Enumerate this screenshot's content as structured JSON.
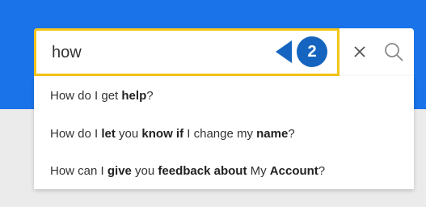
{
  "search": {
    "value": "how",
    "step_number": "2"
  },
  "suggestions": [
    [
      {
        "text": "How do I get ",
        "bold": false
      },
      {
        "text": "help",
        "bold": true
      },
      {
        "text": "?",
        "bold": false
      }
    ],
    [
      {
        "text": "How do I ",
        "bold": false
      },
      {
        "text": "let",
        "bold": true
      },
      {
        "text": " you ",
        "bold": false
      },
      {
        "text": "know if",
        "bold": true
      },
      {
        "text": " I change my ",
        "bold": false
      },
      {
        "text": "name",
        "bold": true
      },
      {
        "text": "?",
        "bold": false
      }
    ],
    [
      {
        "text": "How can I ",
        "bold": false
      },
      {
        "text": "give",
        "bold": true
      },
      {
        "text": " you ",
        "bold": false
      },
      {
        "text": "feedback about",
        "bold": true
      },
      {
        "text": " My ",
        "bold": false
      },
      {
        "text": "Account",
        "bold": true
      },
      {
        "text": "?",
        "bold": false
      }
    ]
  ],
  "icons": {
    "clear": "close-icon",
    "search": "search-icon"
  },
  "colors": {
    "header_blue": "#1a73e8",
    "focus_yellow": "#f5c518",
    "callout_blue": "#1565c0",
    "page_gray": "#ebebeb"
  }
}
